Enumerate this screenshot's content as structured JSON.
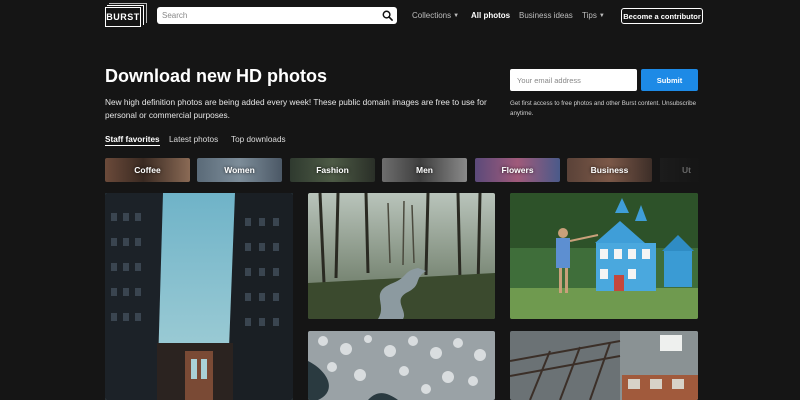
{
  "header": {
    "logo_text": "BURST",
    "search_placeholder": "Search",
    "nav": [
      {
        "label": "Collections",
        "has_caret": true
      },
      {
        "label": "All photos",
        "active": true
      },
      {
        "label": "Business ideas"
      },
      {
        "label": "Tips",
        "has_caret": true
      }
    ],
    "contributor_button": "Become a contributor"
  },
  "hero": {
    "title": "Download new HD photos",
    "subtitle": "New high definition photos are being added every week! These public domain images are free to use for personal or commercial purposes.",
    "email_placeholder": "Your email address",
    "submit_label": "Submit",
    "note": "Get first access to free photos and other Burst content. Unsubscribe anytime."
  },
  "tabs": [
    {
      "label": "Staff favorites",
      "active": true
    },
    {
      "label": "Latest photos"
    },
    {
      "label": "Top downloads"
    }
  ],
  "categories": [
    "Coffee",
    "Women",
    "Fashion",
    "Men",
    "Flowers",
    "Business",
    "Ut"
  ],
  "colors": {
    "background": "#151515",
    "accent": "#1d8ae6"
  }
}
